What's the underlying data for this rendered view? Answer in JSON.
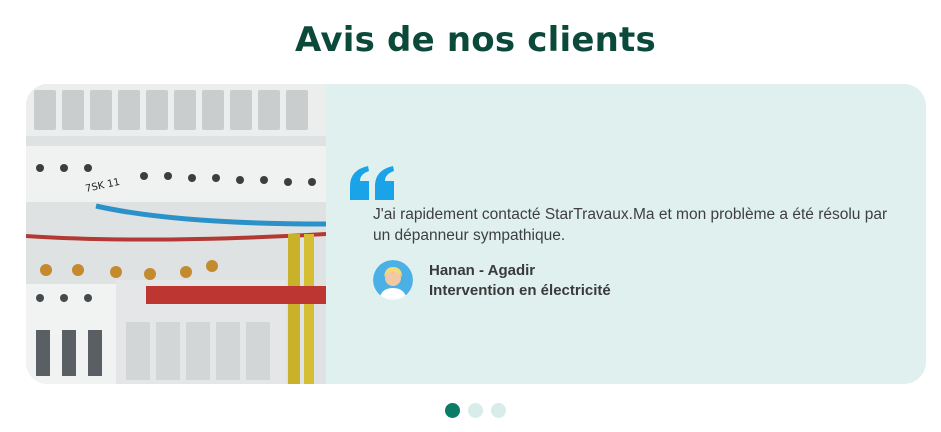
{
  "section": {
    "title": "Avis de nos clients"
  },
  "testimonial": {
    "text": "J'ai rapidement contacté StarTravaux.Ma et mon problème a été résolu par un dépanneur sympathique.",
    "author": "Hanan - Agadir",
    "service": "Intervention en électricité",
    "quote_icon": "quote-icon",
    "avatar_icon": "user-avatar",
    "image_icon": "electrical-panel-photo"
  },
  "carousel": {
    "slide_count": 3,
    "active_index": 0
  },
  "colors": {
    "title": "#0b4a3b",
    "card_background": "#dff0ef",
    "quote_mark": "#1aa3e8",
    "dot_active": "#0d7c66",
    "dot_inactive": "#d8ecea"
  }
}
